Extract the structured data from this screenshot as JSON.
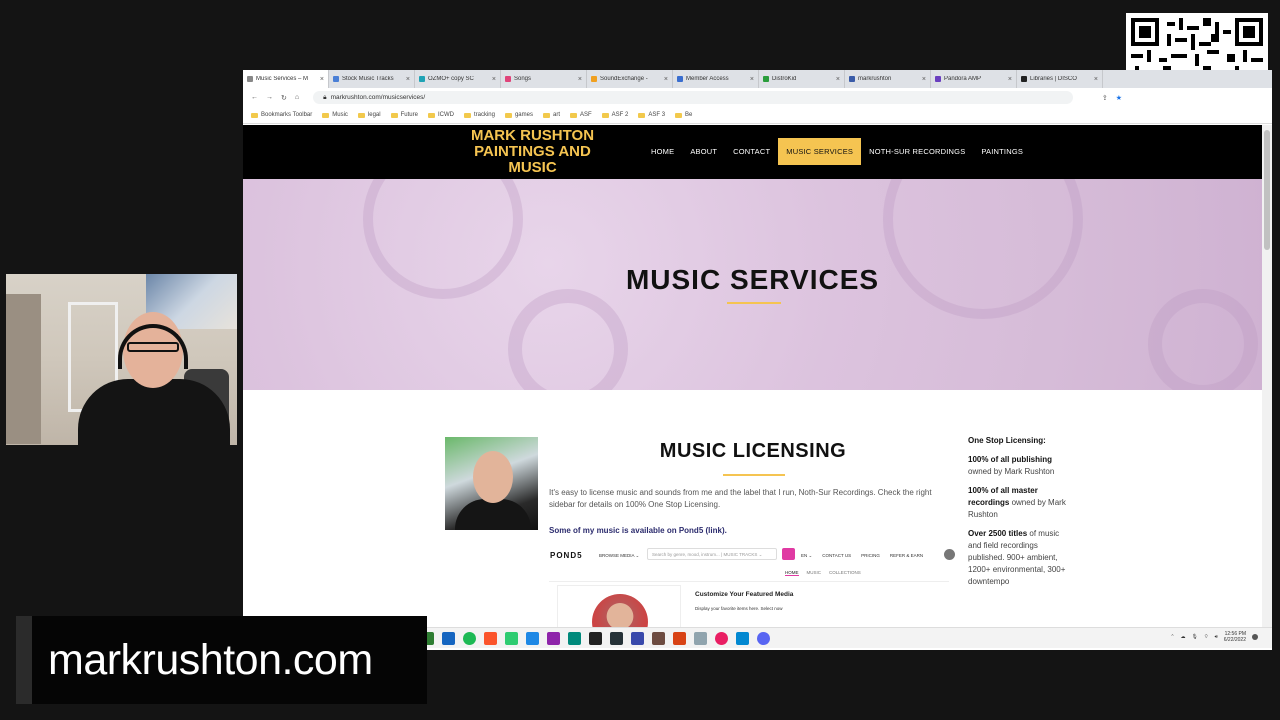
{
  "browser": {
    "tabs": [
      {
        "label": "Music Services – M",
        "icon_color": "#888888",
        "active": true
      },
      {
        "label": "Stock Music Tracks",
        "icon_color": "#4a7fd6"
      },
      {
        "label": "OZMO+ copy SC",
        "icon_color": "#1fa3b5"
      },
      {
        "label": "Songs",
        "icon_color": "#e0447a"
      },
      {
        "label": "SoundExchange -",
        "icon_color": "#f0a020"
      },
      {
        "label": "Member Access",
        "icon_color": "#3a6ecf"
      },
      {
        "label": "DistroKid",
        "icon_color": "#2a9d3c"
      },
      {
        "label": "markrushton",
        "icon_color": "#3a5ba8"
      },
      {
        "label": "Pandora AMP",
        "icon_color": "#6a3fbf"
      },
      {
        "label": "Libraries | DISCO",
        "icon_color": "#222222"
      }
    ],
    "close_glyph": "×",
    "url": "markrushton.com/musicservices/",
    "bookmarks": [
      "Bookmarks Toolbar",
      "Music",
      "legal",
      "Future",
      "ICWD",
      "tracking",
      "games",
      "art",
      "ASF",
      "ASF 2",
      "ASF 3",
      "Be"
    ]
  },
  "site": {
    "logo": "MARK RUSHTON PAINTINGS AND MUSIC",
    "nav": [
      "HOME",
      "ABOUT",
      "CONTACT",
      "MUSIC SERVICES",
      "NOTH-SUR RECORDINGS",
      "PAINTINGS"
    ],
    "active_nav": "MUSIC SERVICES",
    "hero_title": "MUSIC SERVICES",
    "licensing_title": "MUSIC LICENSING",
    "licensing_body": "It's easy to license music and sounds from me and the label that I run, Noth-Sur Recordings.  Check the right sidebar for details on 100% One Stop Licensing.",
    "licensing_link": "Some of my music is available on Pond5 (link).",
    "pond5": {
      "logo": "POND5",
      "browse": "BROWSE MEDIA ⌄",
      "search_placeholder": "Search by genre, mood, instrum...  |  MUSIC TRACKS ⌄",
      "links": [
        "EN ⌄",
        "CONTACT US",
        "PRICING",
        "REFER & EARN"
      ],
      "tabs": [
        "HOME",
        "MUSIC",
        "COLLECTIONS"
      ],
      "featured_title": "Customize Your Featured Media",
      "featured_sub": "Display your favorite items here. Select now"
    },
    "sidebar": {
      "heading": "One Stop Licensing:",
      "p1_bold": "100% of all publishing",
      "p1_rest": "owned by Mark Rushton",
      "p2_bold": "100% of all master recordings",
      "p2_rest": "owned by Mark Rushton",
      "p3_bold": "Over 2500 titles",
      "p3_rest": "of music and field recordings published. 900+ ambient, 1200+ environmental, 300+ downtempo"
    }
  },
  "taskbar": {
    "clock_time": "12:56 PM",
    "clock_date": "6/22/2022"
  },
  "overlay": {
    "domain_text": "markrushton.com"
  },
  "colors": {
    "accent_gold": "#f5c451",
    "hero_pink": "#dcc3de",
    "pond5_pink": "#e03aa3"
  }
}
